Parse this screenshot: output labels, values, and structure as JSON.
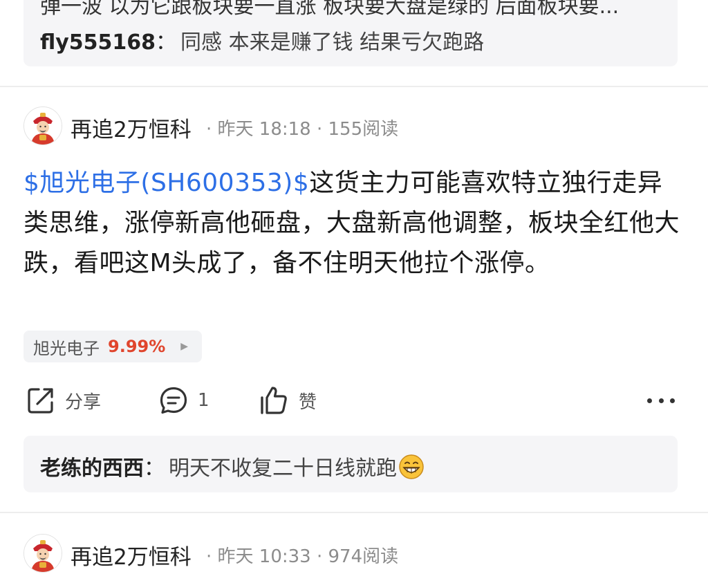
{
  "prev_post": {
    "cutoff_text": "弹一波  以为它跟板块要一直涨  板块要大盘是绿的  后面板块要...",
    "comment": {
      "user": "fly555168",
      "sep": "：",
      "text": "同感 本来是赚了钱 结果亏欠跑路"
    }
  },
  "post1": {
    "author": "再追2万恒科",
    "meta": "· 昨天 18:18 · 155阅读",
    "stock_link": "$旭光电子(SH600353)$",
    "content": "这货主力可能喜欢特立独行走异类思维，涨停新高他砸盘，大盘新高他调整，板块全红他大跌，看吧这M头成了，备不住明天他拉个涨停。",
    "stock_tag": {
      "name": "旭光电子",
      "change": "9.99%"
    },
    "actions": {
      "share": "分享",
      "comment_count": "1",
      "like": "赞"
    },
    "comment": {
      "user": "老练的西西",
      "sep": "：",
      "text": "明天不收复二十日线就跑"
    },
    "colors": {
      "link": "#2d6fe6",
      "up": "#e0452d"
    }
  },
  "post2": {
    "author": "再追2万恒科",
    "meta": "· 昨天 10:33 · 974阅读"
  }
}
